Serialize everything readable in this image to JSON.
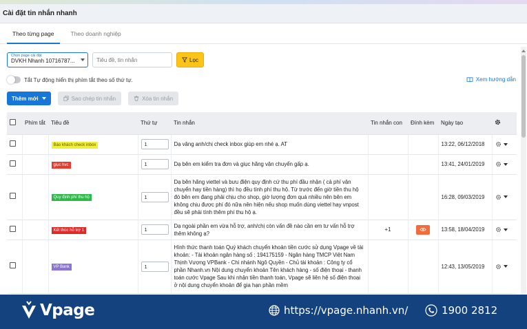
{
  "window": {
    "title": "Cài đặt tin nhắn nhanh"
  },
  "tabs": [
    {
      "label": "Theo từng page",
      "active": true
    },
    {
      "label": "Theo doanh nghiệp",
      "active": false
    }
  ],
  "filters": {
    "page_select_label": "Chọn page cài đặt",
    "page_select_value": "DVKH Nhanh 10716787...",
    "search_placeholder": "Tiêu đề, tin nhắn",
    "filter_button": "Lọc"
  },
  "toggle": {
    "label": "Tắt Tự động hiển thị phím tắt theo số thứ tự.",
    "on": false
  },
  "guide_link": "Xem hướng dẫn",
  "actions": {
    "add_new": "Thêm mới",
    "copy_message": "Sao chép tin nhắn",
    "delete_message": "Xóa tin nhắn"
  },
  "table": {
    "headers": {
      "shortcut": "Phím tắt",
      "title": "Tiêu đề",
      "order": "Thứ tự",
      "message": "Tin nhắn",
      "sub_message": "Tin nhắn con",
      "attachment": "Đính kèm",
      "created": "Ngày tạo"
    },
    "rows": [
      {
        "title": "Báo khách check inbox",
        "tag_color": "#f2ec3b",
        "tag_text_color": "#5a5a00",
        "order": "1",
        "message": "Dạ vâng anh/chị check inbox giúp em nhé ạ. AT",
        "sub": "",
        "attachment": false,
        "created": "13:22, 06/12/2018"
      },
      {
        "title": "giục hvc",
        "tag_color": "#e63b2e",
        "tag_text_color": "#ffffff",
        "order": "1",
        "message": "Dạ bên em kiểm tra đơn và giục hãng vận chuyển gấp ạ.",
        "sub": "",
        "attachment": false,
        "created": "13:41, 24/01/2019"
      },
      {
        "title": "Quy định phí thu hộ",
        "tag_color": "#2fb84a",
        "tag_text_color": "#ffffff",
        "order": "1",
        "message": "Dạ bên hãng viettel và bưu điện quy định cứ thu phí đầu nhận ( cả phí vận chuyển hay tiền hàng) thì họ đều tính phí thu hộ. Từ trước đến giờ tiền thu hộ đó bên em đang phải chịu cho shop, giờ lượng đơn quá nhiều nên bên em không chịu được phí đó nữa nên hiện nếu shop muốn dùng viettel hay vnpost đều sẽ phải tính thêm phí thu hộ ạ.",
        "sub": "",
        "attachment": false,
        "created": "16:28, 09/03/2019"
      },
      {
        "title": "Kết thúc hỗ trợ 1",
        "tag_color": "#e02a2a",
        "tag_text_color": "#ffffff",
        "order": "1",
        "message": "Dạ ngoài phần em vừa hỗ trợ, anh/chị còn vấn đề nào cần em tư vấn hỗ trợ thêm không ạ?",
        "sub": "+1",
        "attachment": true,
        "created": "13:58, 18/04/2019"
      },
      {
        "title": "VP Bank",
        "tag_color": "#8b74d6",
        "tag_text_color": "#ffffff",
        "order": "1",
        "message": "Hình thức thanh toán Quý khách chuyển khoản tiền cước sử dụng Vpage về tài khoản: - Tài khoản ngân hàng số : 194175159 - Ngân hàng TMCP Việt Nam Thịnh Vượng VPBank - Chi nhánh Ngô Quyền - Chủ tài khoản : Công ty cổ phần Nhanh.vn Nội dung chuyển khoản Tên khách hàng - số điện thoại - thanh toán cước Vpage Sau khi nhận tiền thanh toán, Vpage sẽ liên hệ số điện thoại ở nội dung chuyển khoản để gia hạn phần mềm",
        "sub": "",
        "attachment": false,
        "created": "12:43, 13/05/2019"
      }
    ]
  },
  "footer": {
    "brand": "Vpage",
    "url": "https://vpage.nhanh.vn/",
    "phone": "1900 2812"
  },
  "colors": {
    "primary": "#1677d6",
    "filter": "#fcc419",
    "footer_bg": "#14427e",
    "attachment": "#f26b3a"
  }
}
